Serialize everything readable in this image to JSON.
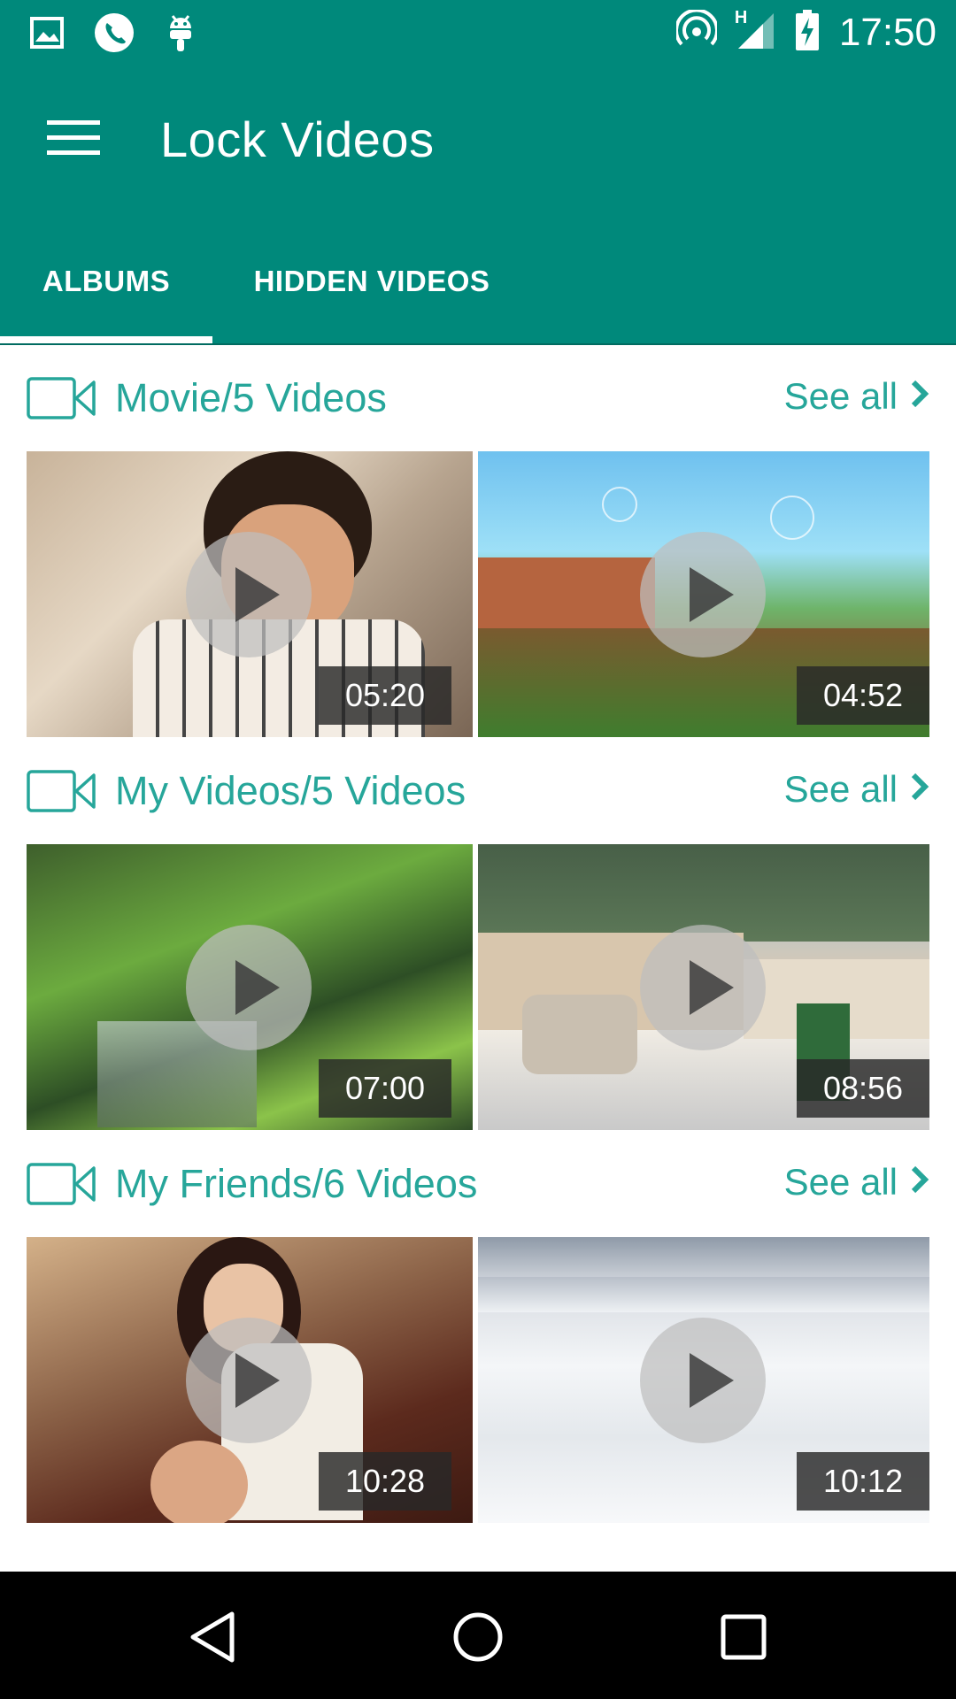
{
  "status_bar": {
    "time": "17:50",
    "network_type": "H",
    "icons": [
      "image-icon",
      "phone-icon",
      "android-icon",
      "hotspot-icon",
      "signal-icon",
      "battery-charging-icon"
    ]
  },
  "app_bar": {
    "title": "Lock Videos",
    "menu_icon": "menu-icon"
  },
  "tabs": [
    {
      "label": "ALBUMS",
      "selected": true
    },
    {
      "label": "HIDDEN VIDEOS",
      "selected": false
    }
  ],
  "albums": [
    {
      "title": "Movie/5 Videos",
      "see_all": "See all",
      "videos": [
        {
          "duration": "05:20"
        },
        {
          "duration": "04:52"
        }
      ]
    },
    {
      "title": "My Videos/5 Videos",
      "see_all": "See all",
      "videos": [
        {
          "duration": "07:00"
        },
        {
          "duration": "08:56"
        }
      ]
    },
    {
      "title": "My Friends/6 Videos",
      "see_all": "See all",
      "videos": [
        {
          "duration": "10:28"
        },
        {
          "duration": "10:12"
        }
      ]
    }
  ],
  "colors": {
    "primary": "#00897b",
    "accent_text": "#26a69a",
    "nav_bar": "#000000"
  },
  "nav_bar": {
    "buttons": [
      "back-icon",
      "home-icon",
      "recents-icon"
    ]
  }
}
